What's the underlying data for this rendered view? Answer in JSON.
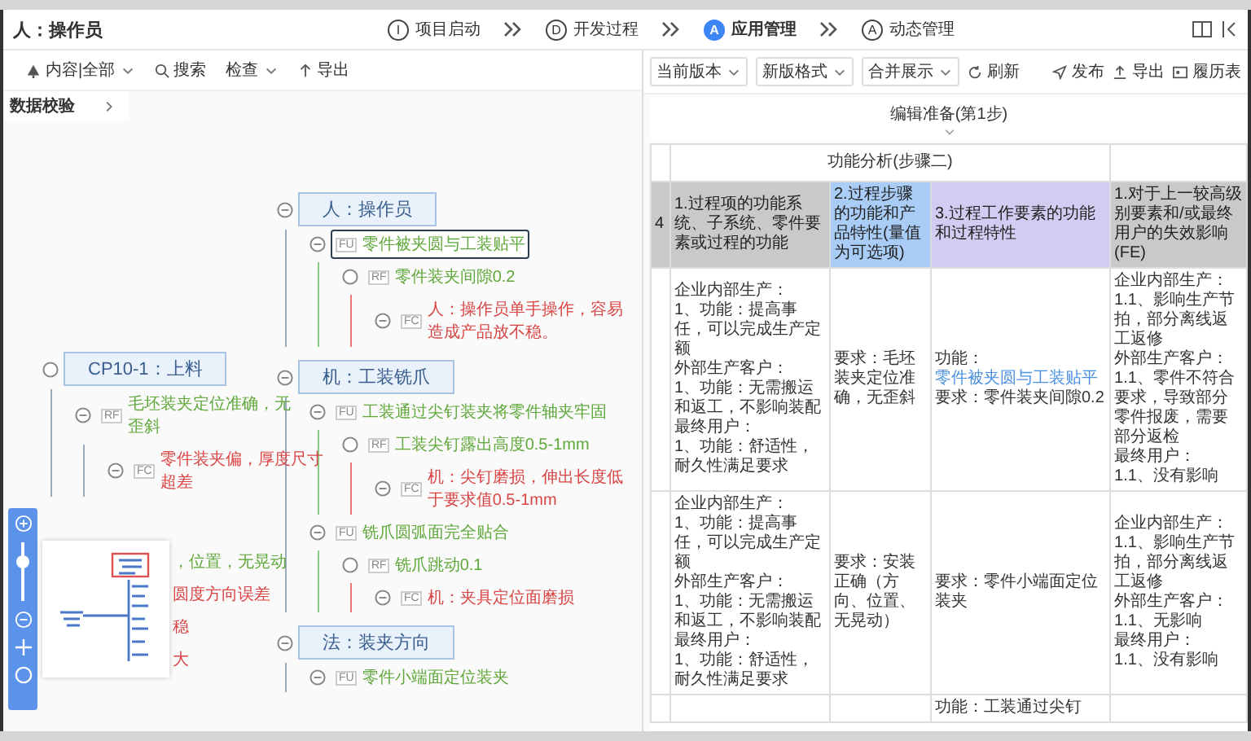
{
  "header": {
    "title": "人：操作员",
    "steps": [
      {
        "badge": "I",
        "label": "项目启动",
        "selected": false
      },
      {
        "badge": "D",
        "label": "开发过程",
        "selected": false
      },
      {
        "badge": "A",
        "label": "应用管理",
        "selected": true
      },
      {
        "badge": "A",
        "label": "动态管理",
        "selected": false
      }
    ]
  },
  "left_toolbar": [
    {
      "label": "内容|全部",
      "kind": "filter"
    },
    {
      "label": "搜索",
      "kind": "search"
    },
    {
      "label": "检查",
      "kind": "dropdown"
    },
    {
      "label": "导出",
      "kind": "export"
    }
  ],
  "side_tab": {
    "label": "数据校验"
  },
  "mindmap": {
    "root": {
      "label": "CP10-1：上料",
      "children": [
        {
          "tag": "RF",
          "text": "毛坯装夹定位准确，无歪斜",
          "kind": "characteristic",
          "selected": false,
          "children": [
            {
              "tag": "FC",
              "text": "零件装夹偏，厚度尺寸超差",
              "kind": "failure",
              "selected": false
            }
          ]
        }
      ]
    },
    "covered_tails": [
      {
        "text": "，位置，无晃动",
        "kind": "characteristic"
      },
      {
        "text": "圆度方向误差",
        "kind": "failure"
      },
      {
        "text": "稳",
        "kind": "failure"
      },
      {
        "text": "大",
        "kind": "failure"
      }
    ],
    "branches": [
      {
        "label": "人：操作员",
        "children": [
          {
            "tag": "FU",
            "text": "零件被夹圆与工装贴平",
            "kind": "function",
            "selected": true,
            "children": [
              {
                "tag": "RF",
                "text": "零件装夹间隙0.2",
                "kind": "characteristic",
                "selected": false,
                "children": [
                  {
                    "tag": "FC",
                    "text": "人：操作员单手操作，容易造成产品放不稳。",
                    "kind": "failure",
                    "selected": false
                  }
                ]
              }
            ]
          }
        ]
      },
      {
        "label": "机：工装铣爪",
        "children": [
          {
            "tag": "FU",
            "text": "工装通过尖钉装夹将零件轴夹牢固",
            "kind": "function",
            "selected": false,
            "children": [
              {
                "tag": "RF",
                "text": "工装尖钉露出高度0.5-1mm",
                "kind": "characteristic",
                "selected": false,
                "children": [
                  {
                    "tag": "FC",
                    "text": "机：尖钉磨损，伸出长度低于要求值0.5-1mm",
                    "kind": "failure",
                    "selected": false
                  }
                ]
              }
            ]
          },
          {
            "tag": "FU",
            "text": "铣爪圆弧面完全贴合",
            "kind": "function",
            "selected": false,
            "children": [
              {
                "tag": "RF",
                "text": "铣爪跳动0.1",
                "kind": "characteristic",
                "selected": false,
                "children": [
                  {
                    "tag": "FC",
                    "text": "机：夹具定位面磨损",
                    "kind": "failure",
                    "selected": false
                  }
                ]
              }
            ]
          }
        ]
      },
      {
        "label": "法：装夹方向",
        "children": [
          {
            "tag": "FU",
            "text": "零件小端面定位装夹",
            "kind": "function",
            "selected": false
          }
        ]
      }
    ]
  },
  "zoom_slider": {
    "level": 0.67
  },
  "right_toolbar": [
    {
      "label": "当前版本",
      "kind": "select"
    },
    {
      "label": "新版格式",
      "kind": "select"
    },
    {
      "label": "合并展示",
      "kind": "select"
    },
    {
      "label": "刷新",
      "kind": "refresh"
    }
  ],
  "actions": [
    {
      "label": "发布",
      "kind": "send"
    },
    {
      "label": "导出",
      "kind": "export"
    },
    {
      "label": "履历表",
      "kind": "history"
    }
  ],
  "section_title": "编辑准备(第1步)",
  "table": {
    "group_header": "功能分析(步骤二)",
    "columns": [
      {
        "text": "4",
        "color": "#c9c9c9"
      },
      {
        "text": "1.过程项的功能系统、子系统、零件要素或过程的功能",
        "color": "#c9c9c9"
      },
      {
        "text": "2.过程步骤的功能和产品特性(量值为可选项)",
        "color": "#a9cdf7"
      },
      {
        "text": "3.过程工作要素的功能和过程特性",
        "color": "#d3ccf2"
      },
      {
        "text": "1.对于上一较高级别要素和/或最终用户的失效影响 (FE)",
        "color": "#c9c9c9"
      }
    ],
    "rows": [
      {
        "cells": [
          "",
          {
            "lines": [
              {
                "text": "企业内部生产："
              },
              {
                "text": "1、功能：提高事任，可以完成生产定额"
              },
              {
                "text": "外部生产客户："
              },
              {
                "text": "1、功能：无需搬运和返工，不影响装配"
              },
              {
                "text": "最终用户："
              },
              {
                "text": "1、功能：舒适性，耐久性满足要求"
              }
            ]
          },
          {
            "lines": [
              {
                "text": "要求：毛坯装夹定位准确，无歪斜"
              }
            ]
          },
          {
            "lines": [
              {
                "text": "功能：",
                "link": "零件被夹圆与工装贴平"
              },
              {
                "text": "要求：零件装夹间隙0.2"
              }
            ]
          },
          {
            "lines": [
              {
                "text": "企业内部生产："
              },
              {
                "text": "1.1、影响生产节拍，部分离线返工返修"
              },
              {
                "text": "外部生产客户："
              },
              {
                "text": "1.1、零件不符合要求，导致部分零件报废，需要部分返检"
              },
              {
                "text": "最终用户："
              },
              {
                "text": "1.1、没有影响"
              }
            ]
          }
        ]
      },
      {
        "cells": [
          "",
          {
            "lines": [
              {
                "text": "企业内部生产："
              },
              {
                "text": "1、功能：提高事任，可以完成生产定额"
              },
              {
                "text": "外部生产客户："
              },
              {
                "text": "1、功能：无需搬运和返工，不影响装配"
              },
              {
                "text": "最终用户："
              },
              {
                "text": "1、功能：舒适性，耐久性满足要求"
              }
            ]
          },
          {
            "lines": [
              {
                "text": "要求：安装正确（方向、位置、无晃动）"
              }
            ]
          },
          {
            "lines": [
              {
                "text": "要求：零件小端面定位装夹"
              }
            ]
          },
          {
            "lines": [
              {
                "text": "企业内部生产："
              },
              {
                "text": "1.1、影响生产节拍，部分离线返工返修"
              },
              {
                "text": "外部生产客户："
              },
              {
                "text": "1.1、无影响"
              },
              {
                "text": "最终用户："
              },
              {
                "text": "1.1、没有影响"
              }
            ]
          }
        ]
      },
      {
        "cells": [
          "",
          "",
          "",
          {
            "lines": [
              {
                "text": "功能：工装通过尖钉"
              }
            ]
          },
          ""
        ]
      }
    ]
  }
}
